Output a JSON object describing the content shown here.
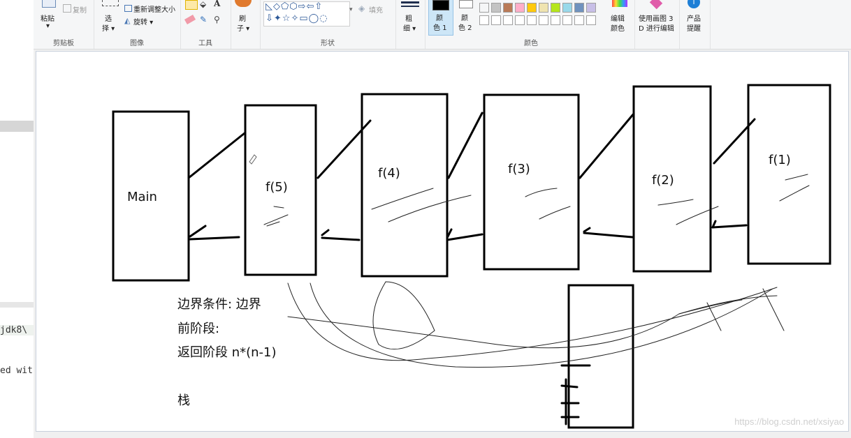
{
  "left_panel": {
    "code_line_1": "jdk8\\",
    "code_line_2": "ed wit"
  },
  "ribbon": {
    "clipboard": {
      "paste": "粘贴",
      "copy": "复制",
      "group": "剪贴板"
    },
    "image": {
      "select_1": "选",
      "select_2": "择",
      "resize": "重新调整大小",
      "rotate": "旋转",
      "group": "图像"
    },
    "tools": {
      "group": "工具"
    },
    "brush": {
      "label_1": "刷",
      "label_2": "子"
    },
    "shapes": {
      "fill": "填充",
      "group": "形状"
    },
    "size": {
      "label_1": "粗",
      "label_2": "细"
    },
    "color1": {
      "label_1": "颜",
      "label_2": "色 1"
    },
    "color2": {
      "label_1": "颜",
      "label_2": "色 2"
    },
    "colors": {
      "group": "颜色",
      "edit_1": "编辑",
      "edit_2": "颜色"
    },
    "paint3d": {
      "label_1": "使用画图 3",
      "label_2": "D 进行编辑"
    },
    "product": {
      "label_1": "产品",
      "label_2": "提醒"
    },
    "palette": [
      "#ffffff",
      "#c3c3c3",
      "#b97a57",
      "#ffaec9",
      "#ffc90e",
      "#efe4b0",
      "#b5e61d",
      "#99d9ea",
      "#7092be",
      "#c8bfe7"
    ]
  },
  "canvas": {
    "boxes": {
      "main": "Main",
      "f5": "f(5)",
      "f4": "f(4)",
      "f3": "f(3)",
      "f2": "f(2)",
      "f1": "f(1)"
    },
    "notes": {
      "line1": "边界条件: 边界",
      "line2": "前阶段:",
      "line3": "返回阶段  n*(n-1)",
      "line4": "栈"
    },
    "watermark": "https://blog.csdn.net/xsiyao"
  }
}
